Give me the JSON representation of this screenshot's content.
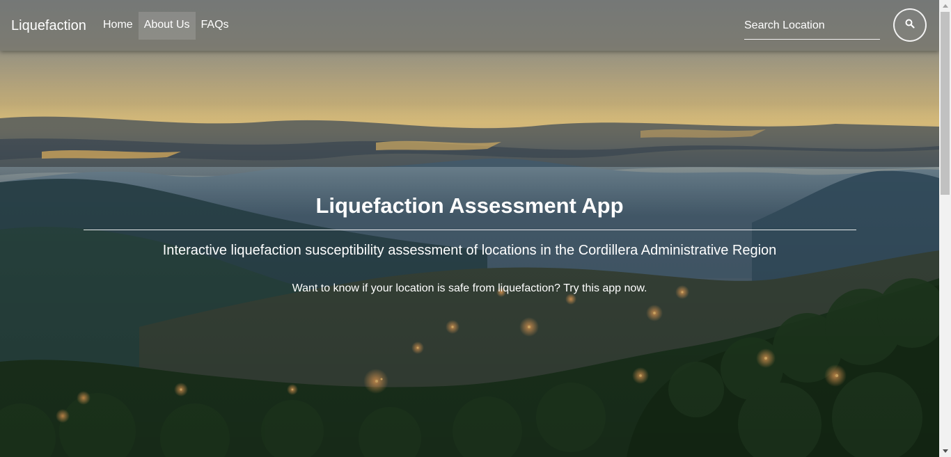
{
  "navbar": {
    "brand": "Liquefaction",
    "links": [
      {
        "label": "Home",
        "active": false
      },
      {
        "label": "About Us",
        "active": true
      },
      {
        "label": "FAQs",
        "active": false
      }
    ],
    "search": {
      "placeholder": "Search Location",
      "value": "",
      "button_icon": "search-icon"
    }
  },
  "hero": {
    "title": "Liquefaction Assessment App",
    "subtitle": "Interactive liquefaction susceptibility assessment of locations in the Cordillera Administrative Region",
    "cta": "Want to know if your location is safe from liquefaction? Try this app now."
  },
  "colors": {
    "navbar_overlay": "#69696480",
    "text": "#ffffff",
    "sky_top": "#7c8a95",
    "sunset_glow": "#e8c070",
    "mountain_far": "#3c5566",
    "forest": "#1f3a22"
  }
}
